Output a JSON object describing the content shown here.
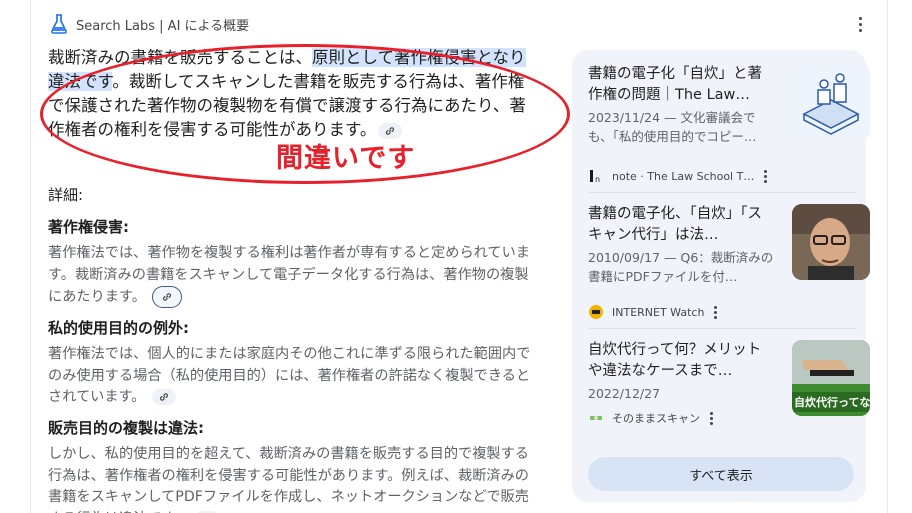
{
  "header": {
    "title": "Search Labs | AI による概要"
  },
  "answer": {
    "lead_plain1": "裁断済みの書籍を販売することは、",
    "lead_highlight": "原則として著作権侵害となり違法です",
    "lead_plain2": "。裁断してスキャンした書籍を販売する行為は、著作権で保護された著作物の複製物を有償で譲渡する行為にあたり、著作権者の権利を侵害する可能性があります。",
    "annotation": "間違いです",
    "details_label": "詳細:",
    "sections": [
      {
        "title": "著作権侵害:",
        "body": "著作権法では、著作物を複製する権利は著作者が専有すると定められています。裁断済みの書籍をスキャンして電子データ化する行為は、著作物の複製にあたります。"
      },
      {
        "title": "私的使用目的の例外:",
        "body": "著作権法では、個人的にまたは家庭内その他これに準ずる限られた範囲内でのみ使用する場合（私的使用目的）には、著作権者の許諾なく複製できるとされています。"
      },
      {
        "title": "販売目的の複製は違法:",
        "body": "しかし、私的使用目的を超えて、裁断済みの書籍を販売する目的で複製する行為は、著作権者の権利を侵害する可能性があります。例えば、裁断済みの書籍をスキャンしてPDFファイルを作成し、ネットオークションなどで販売する行為は違法です。"
      }
    ]
  },
  "sources": {
    "cards": [
      {
        "title": "書籍の電子化「自炊」と著作権の問題｜The Law…",
        "desc": "2023/11/24 — 文化審議会でも、「私的使用目的でコピー…",
        "source": "note · The Law School T…",
        "thumb_caption": ""
      },
      {
        "title": "書籍の電子化、「自炊」「スキャン代行」は法…",
        "desc": "2010/09/17 — Q6：裁断済みの書籍にPDFファイルを付…",
        "source": "INTERNET Watch",
        "thumb_caption": ""
      },
      {
        "title": "自炊代行って何？メリットや違法なケースまで…",
        "desc": "2022/12/27",
        "source": "そのままスキャン",
        "thumb_caption": "自炊代行ってな"
      }
    ],
    "show_all": "すべて表示"
  },
  "colors": {
    "highlight": "#d3e3fd",
    "annotation": "#e8202a",
    "panel": "#f0f4fa"
  }
}
